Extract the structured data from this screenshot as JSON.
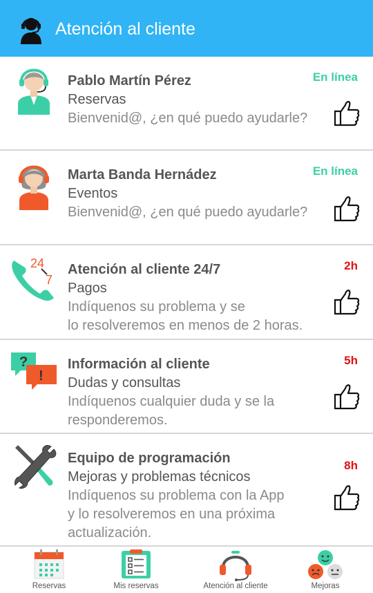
{
  "header": {
    "title": "Atención al cliente",
    "icon": "headset-user-icon",
    "color": "#30b4f5"
  },
  "contacts": [
    {
      "name": "Pablo Martín Pérez",
      "department": "Reservas",
      "message": "Bienvenid@, ¿en qué puedo ayudarle?",
      "status": "En línea",
      "icon": "male-agent-avatar"
    },
    {
      "name": "Marta Banda Hernádez",
      "department": "Eventos",
      "message": "Bienvenid@, ¿en qué puedo ayudarle?",
      "status": "En línea",
      "icon": "female-agent-avatar"
    },
    {
      "name": "Atención al cliente 24/7",
      "department": "Pagos",
      "message_line1": "Indíquenos su problema y se",
      "message_line2": "lo resolveremos en menos de 2 horas.",
      "status": "2h",
      "icon": "phone-24-7-icon"
    },
    {
      "name": "Información al cliente",
      "department": "Dudas y consultas",
      "message_line1": "Indíquenos cualquier duda y se la",
      "message_line2": "responderemos.",
      "status": "5h",
      "icon": "chat-bubbles-icon"
    },
    {
      "name": "Equipo de programación",
      "department": "Mejoras y problemas técnicos",
      "message_line1": "Indíquenos su problema con la App",
      "message_line2": "y lo resolveremos en una próxima",
      "message_line3": "actualización.",
      "status": "8h",
      "icon": "tools-icon"
    }
  ],
  "tabs": [
    {
      "label": "Reservas",
      "icon": "calendar-icon"
    },
    {
      "label": "Mis reservas",
      "icon": "checklist-icon"
    },
    {
      "label": "Atención al cliente",
      "icon": "headset-icon"
    },
    {
      "label": "Mejoras",
      "icon": "smileys-icon"
    }
  ],
  "colors": {
    "online": "#3ccfa6",
    "time": "#e31010",
    "text_dark": "#555555",
    "text_light": "#8a8a8a"
  }
}
